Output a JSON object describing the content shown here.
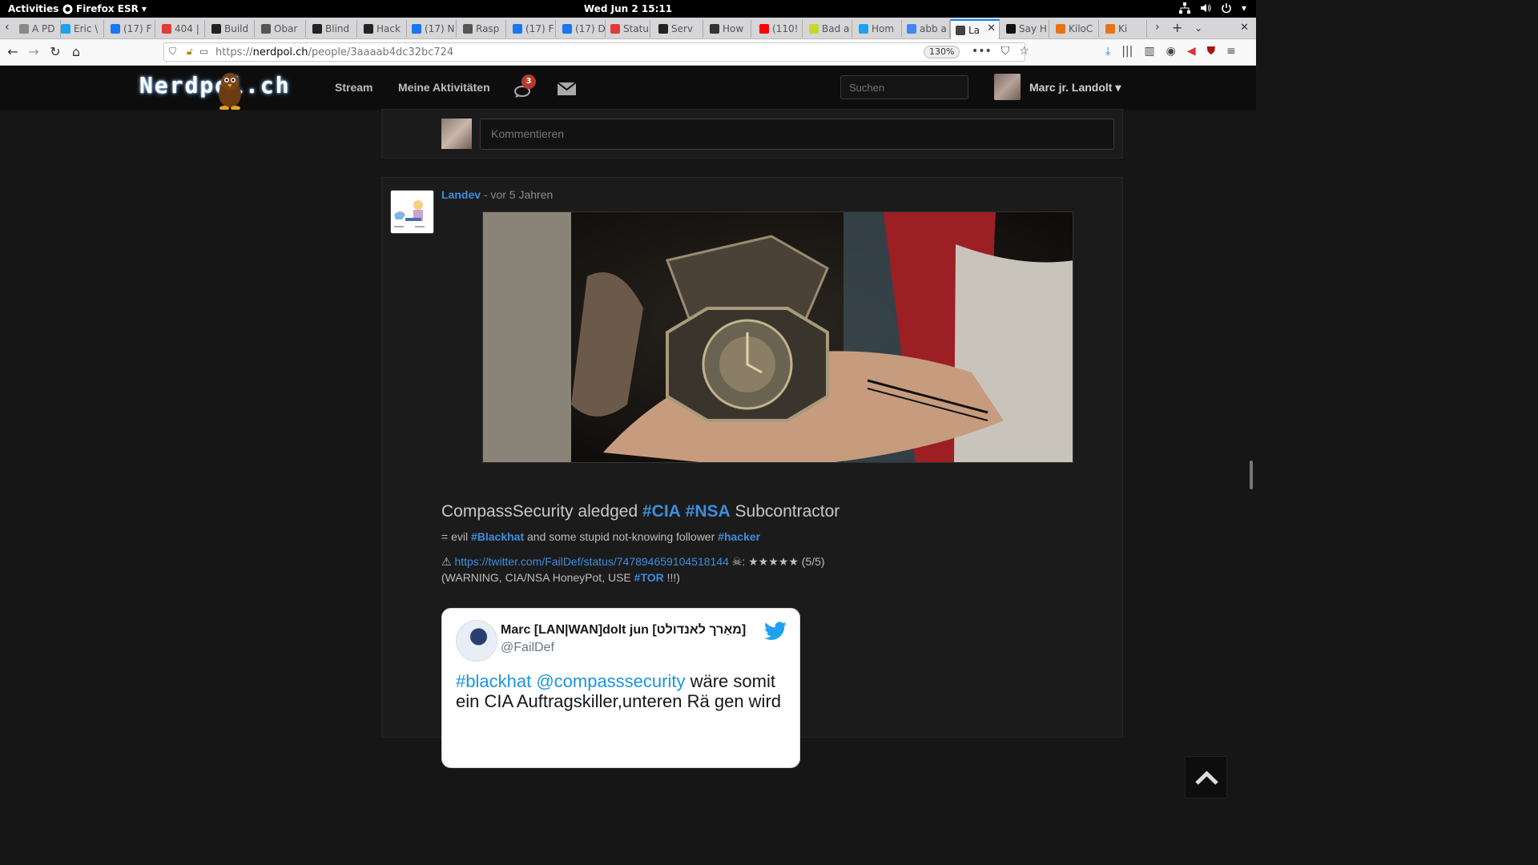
{
  "gnome": {
    "activities": "Activities",
    "app_name": "Firefox ESR",
    "clock": "Wed Jun 2  15:11"
  },
  "tabs": [
    {
      "label": "A PD",
      "favicon_color": "#888888"
    },
    {
      "label": "Eric \\",
      "favicon_color": "#1da1f2"
    },
    {
      "label": "(17) F",
      "favicon_color": "#1877f2"
    },
    {
      "label": "404 |",
      "favicon_color": "#e03b3b"
    },
    {
      "label": "Build",
      "favicon_color": "#222222"
    },
    {
      "label": "Obar",
      "favicon_color": "#555555"
    },
    {
      "label": "Blind",
      "favicon_color": "#222222"
    },
    {
      "label": "Hack",
      "favicon_color": "#222222"
    },
    {
      "label": "(17) N",
      "favicon_color": "#1877f2"
    },
    {
      "label": "Rasp",
      "favicon_color": "#555555"
    },
    {
      "label": "(17) F",
      "favicon_color": "#1877f2"
    },
    {
      "label": "(17) D",
      "favicon_color": "#1877f2"
    },
    {
      "label": "Statu",
      "favicon_color": "#e03b3b"
    },
    {
      "label": "Serv",
      "favicon_color": "#222222"
    },
    {
      "label": "How",
      "favicon_color": "#333333"
    },
    {
      "label": "(110!",
      "favicon_color": "#ff0000"
    },
    {
      "label": "Bad a",
      "favicon_color": "#c6d82b"
    },
    {
      "label": "Hom",
      "favicon_color": "#1da1f2"
    },
    {
      "label": "abb a",
      "favicon_color": "#4285f4"
    },
    {
      "label": "La",
      "favicon_color": "#444444"
    },
    {
      "label": "Say H",
      "favicon_color": "#111111"
    },
    {
      "label": "KiloC",
      "favicon_color": "#e8731a"
    },
    {
      "label": "Ki",
      "favicon_color": "#e8731a"
    }
  ],
  "nav": {
    "url_prefix": "https://",
    "url_domain": "nerdpol.ch",
    "url_path": "/people/3aaaab4dc32bc724",
    "zoom": "130%"
  },
  "site": {
    "logo": "Nerdpol.ch",
    "nav_stream": "Stream",
    "nav_activity": "Meine Aktivitäten",
    "notif_count": "3",
    "search_placeholder": "Suchen",
    "user_name": "Marc jr. Landolt"
  },
  "comment": {
    "placeholder": "Kommentieren"
  },
  "post": {
    "author": "Landev",
    "time": "vor 5 Jahren",
    "title_pre": "CompassSecurity aledged ",
    "title_tag1": "#CIA",
    "title_tag2": "#NSA",
    "title_post": " Subcontractor",
    "line1_pre": "= evil ",
    "line1_tag1": "#Blackhat",
    "line1_mid": " and some stupid not-knowing follower ",
    "line1_tag2": "#hacker",
    "line2_warn": "⚠ ",
    "line2_link": "https://twitter.com/FailDef/status/747894659104518144",
    "line2_rest": " ☠: ★★★★★ (5/5)",
    "line3_pre": "(WARNING, CIA/NSA HoneyPot, USE ",
    "line3_tag": "#TOR",
    "line3_post": " !!!)"
  },
  "tweet": {
    "name": "Marc [LAN|WAN]dolt jun [מאַרך לאנדולט]",
    "handle": "@FailDef",
    "text_link1": "#blackhat",
    "text_link2": "@compasssecurity",
    "text_rest": " wäre somit ein CIA Auftragskiller,unteren Rä gen wird"
  },
  "colors": {
    "accent": "#3e8ede",
    "badge": "#b53a2d",
    "tweet_link": "#1b95e0"
  }
}
